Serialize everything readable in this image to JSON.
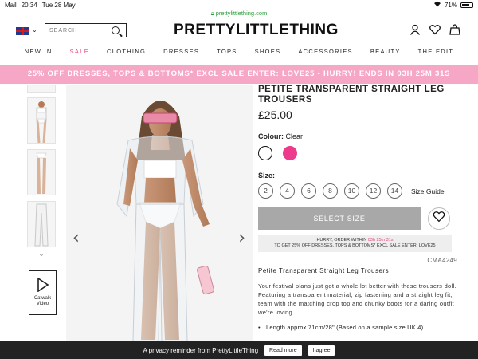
{
  "status": {
    "carrier": "Mail",
    "time": "20:34",
    "date": "Tue 28 May",
    "battery": "71%",
    "battery_level": 0.71
  },
  "browser": {
    "url": "prettylittlething.com"
  },
  "header": {
    "logo": "PRETTYLITTLETHING",
    "search_placeholder": "SEARCH"
  },
  "nav": [
    "NEW IN",
    "SALE",
    "CLOTHING",
    "DRESSES",
    "TOPS",
    "SHOES",
    "ACCESSORIES",
    "BEAUTY",
    "THE EDIT"
  ],
  "promo": "25% OFF DRESSES, TOPS & BOTTOMS* EXCL SALE ENTER: LOVE25 - HURRY! ENDS IN 03H 25M 31S",
  "thumbs": {
    "catwalk_label": "Catwalk Video"
  },
  "product": {
    "title": "PETITE TRANSPARENT STRAIGHT LEG TROUSERS",
    "price": "£25.00",
    "colour_label": "Colour:",
    "colour_value": "Clear",
    "swatch_colors": [
      "#ffffff",
      "#ee3a8c"
    ],
    "size_label": "Size:",
    "sizes": [
      "2",
      "4",
      "6",
      "8",
      "10",
      "12",
      "14"
    ],
    "size_guide": "Size Guide",
    "select_size": "SELECT SIZE",
    "hurry_line1_a": "HURRY, ORDER WITHIN",
    "hurry_timer": "03h 25m 31s",
    "hurry_line2": "TO GET 25% OFF DRESSES, TOPS & BOTTOMS* EXCL SALE ENTER: LOVE25",
    "code": "CMA4249",
    "subtitle": "Petite Transparent Straight Leg Trousers",
    "description": "Your festival plans just got a whole lot better with these trousers doll. Featuring a transparent material, zip fastening and a straight leg fit, team with the matching crop top and chunky boots for a daring outfit we're loving.",
    "bullet": "Length approx 71cm/28\" (Based on a sample size UK 4)"
  },
  "privacy": {
    "text": "A privacy reminder from PrettyLittleThing",
    "read_more": "Read more",
    "agree": "I agree"
  }
}
